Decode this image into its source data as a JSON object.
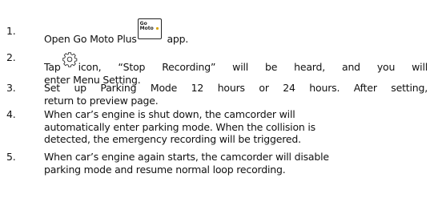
{
  "steps": [
    {
      "number": "1.",
      "before": "Open Go Moto Plus",
      "after": "app.",
      "app_icon_text": [
        "Go",
        "Moto"
      ]
    },
    {
      "number": "2.",
      "line1_before": "Tap",
      "line1_after": "icon, “Stop Recording” will be heard, and you will",
      "line2": "enter Menu Setting."
    },
    {
      "number": "3.",
      "line1": "Set up Parking Mode 12 hours or 24 hours. After setting,",
      "line2": "return to preview page."
    },
    {
      "number": "4.",
      "line1": "When car’s engine is shut down, the camcorder will",
      "line2": "automatically enter parking mode. When the collision is",
      "line3": "detected, the emergency recording will be triggered."
    },
    {
      "number": "5.",
      "line1": "When car’s engine again starts, the camcorder will disable",
      "line2": "parking mode and resume normal loop recording."
    }
  ],
  "icons": {
    "app": "go-moto-app-icon",
    "settings": "gear-icon"
  }
}
